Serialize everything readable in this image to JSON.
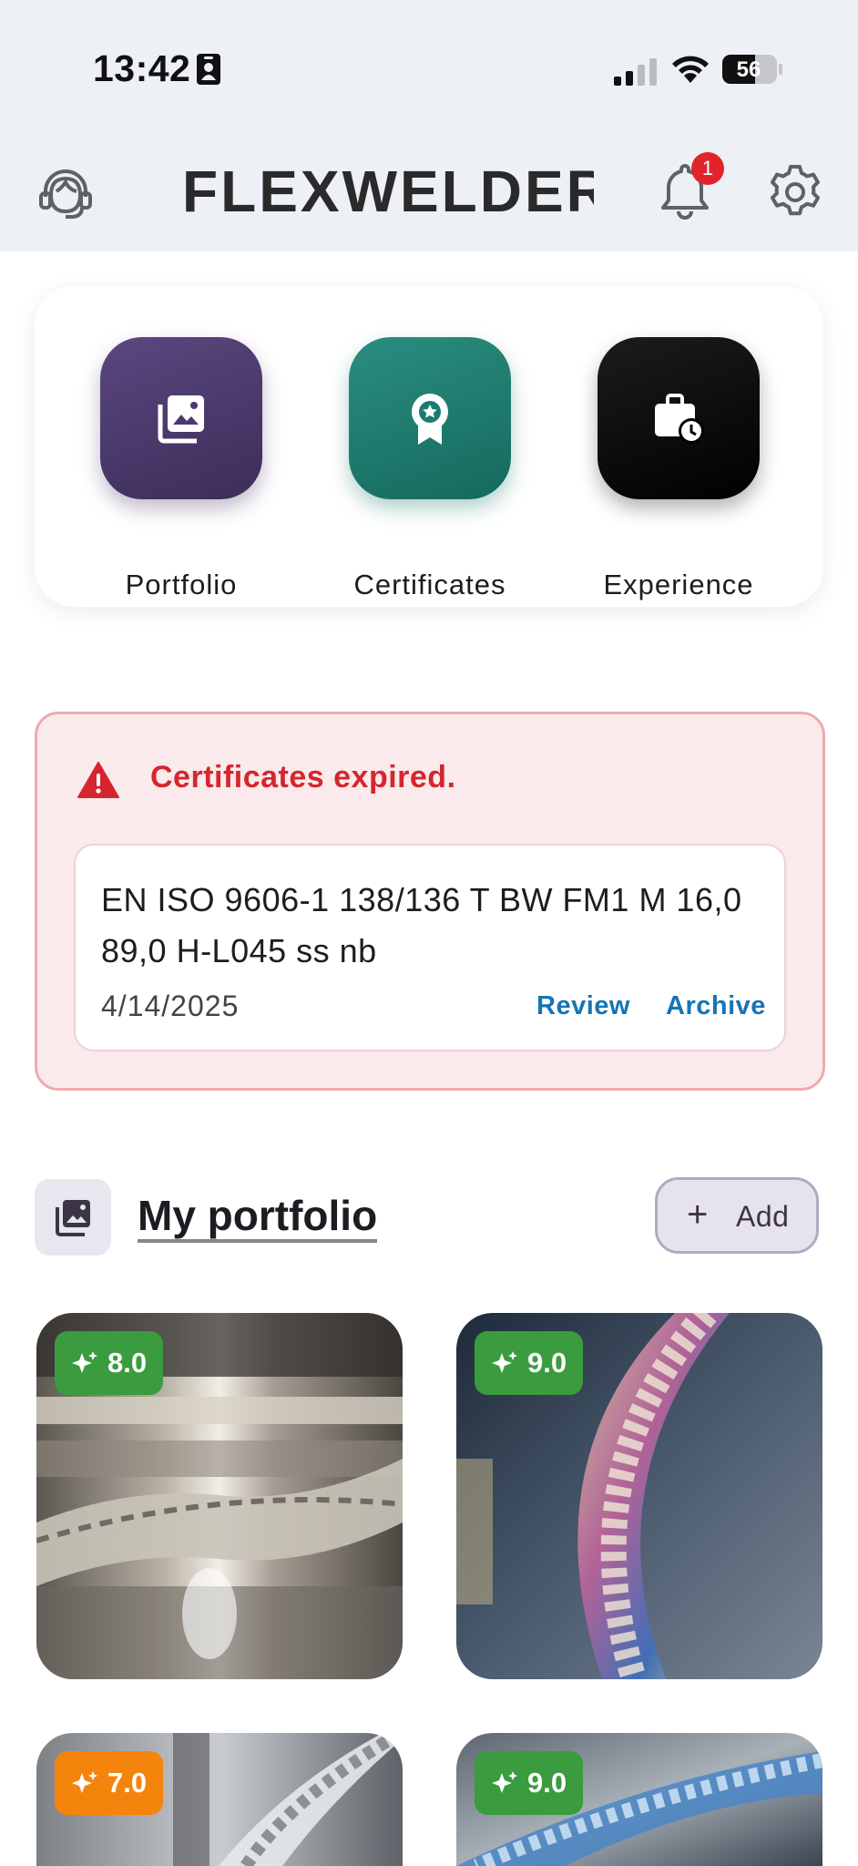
{
  "status_bar": {
    "time": "13:42",
    "battery": "56"
  },
  "header": {
    "brand": "FLEXWELDER",
    "notification_count": "1"
  },
  "quick_links": [
    {
      "label": "Portfolio",
      "color": "#4b3a6c"
    },
    {
      "label": "Certificates",
      "color": "#1c7b6e"
    },
    {
      "label": "Experience",
      "color": "#0c0c0c"
    }
  ],
  "alert": {
    "title": "Certificates expired.",
    "certificate": {
      "title": "EN ISO 9606-1 138/136 T BW FM1 M 16,0 89,0 H-L045 ss nb",
      "date": "4/14/2025",
      "review_label": "Review",
      "archive_label": "Archive"
    }
  },
  "portfolio": {
    "title": "My portfolio",
    "add_label": "Add",
    "items": [
      {
        "score": "8.0",
        "badge_color": "#3a9b3f"
      },
      {
        "score": "9.0",
        "badge_color": "#3a9b3f"
      },
      {
        "score": "7.0",
        "badge_color": "#f5840c"
      },
      {
        "score": "9.0",
        "badge_color": "#3a9b3f"
      }
    ]
  }
}
